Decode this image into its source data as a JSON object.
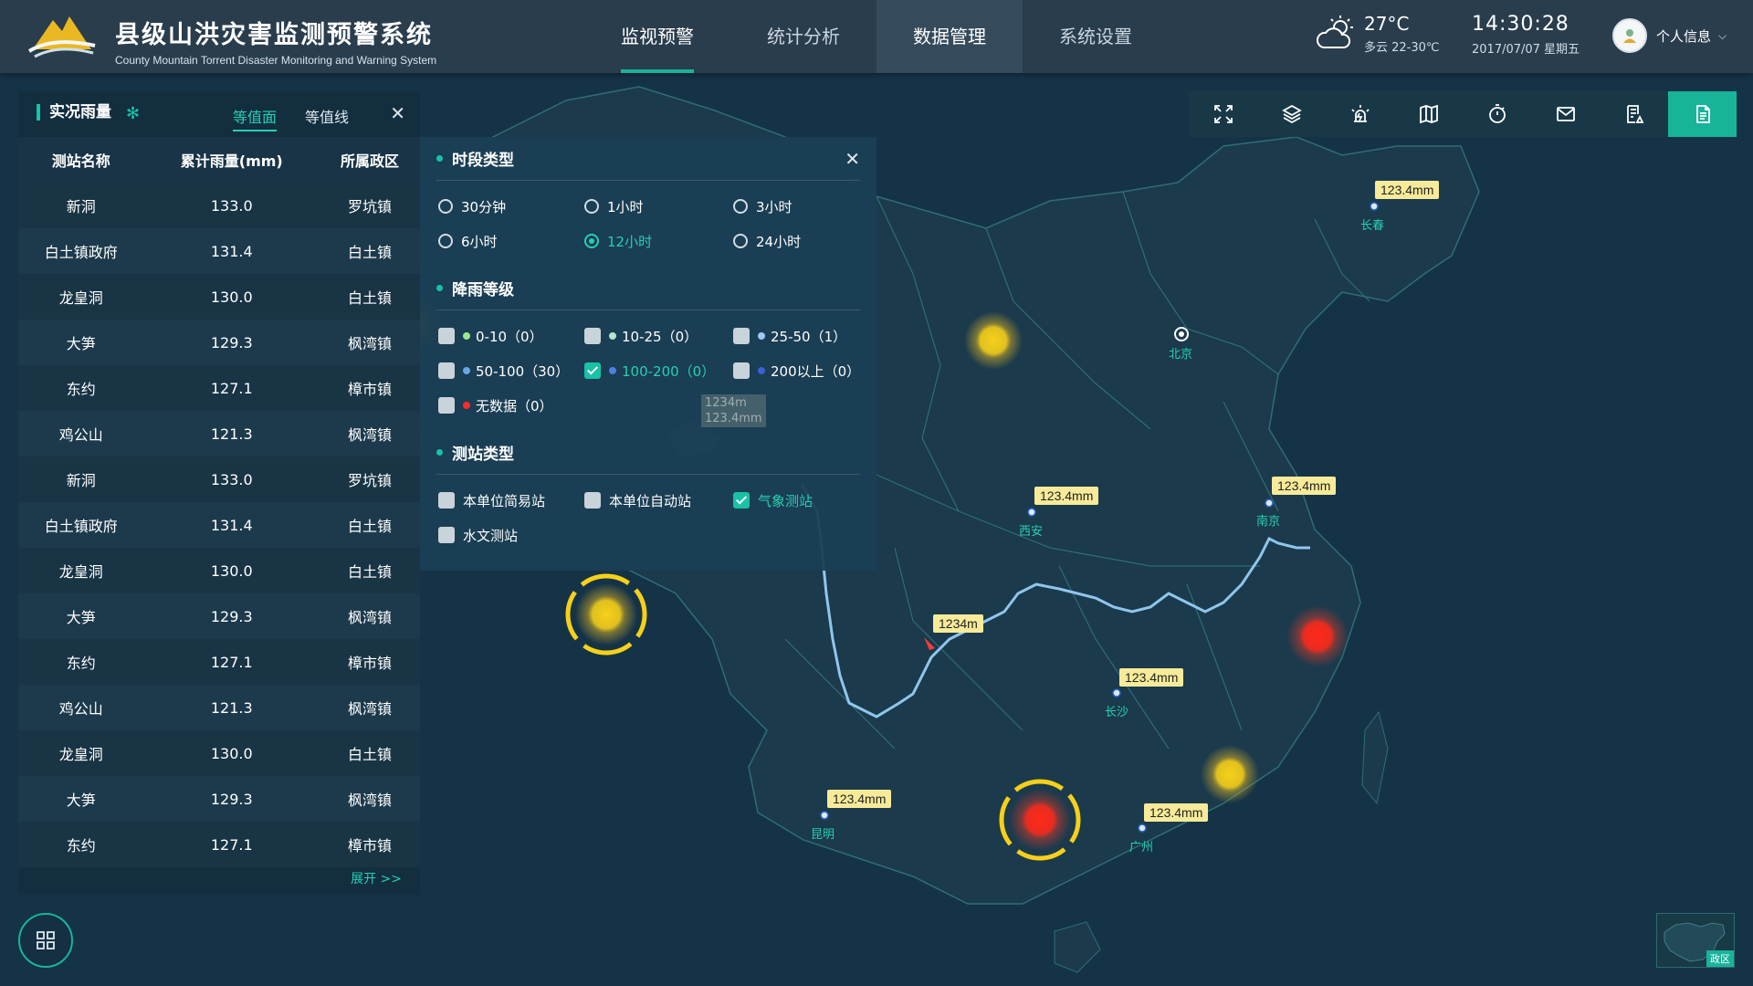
{
  "header": {
    "title_cn": "县级山洪灾害监测预警系统",
    "title_en": "County Mountain Torrent Disaster Monitoring and Warning System",
    "nav": [
      {
        "label": "监视预警",
        "state": "active"
      },
      {
        "label": "统计分析",
        "state": ""
      },
      {
        "label": "数据管理",
        "state": "hover"
      },
      {
        "label": "系统设置",
        "state": ""
      }
    ],
    "weather": {
      "temp": "27°C",
      "desc": "多云 22-30℃",
      "icon": "cloud-sun-icon"
    },
    "clock": {
      "time": "14:30:28",
      "date": "2017/07/07 星期五"
    },
    "user": {
      "label": "个人信息",
      "caret": "⌵"
    }
  },
  "rain_panel": {
    "title": "实况雨量",
    "tabs": [
      "等值面",
      "等值线"
    ],
    "active_tab": 0,
    "columns": [
      "测站名称",
      "累计雨量(mm)",
      "所属政区"
    ],
    "rows": [
      [
        "新洞",
        "133.0",
        "罗坑镇"
      ],
      [
        "白土镇政府",
        "131.4",
        "白土镇"
      ],
      [
        "龙皇洞",
        "130.0",
        "白土镇"
      ],
      [
        "大笋",
        "129.3",
        "枫湾镇"
      ],
      [
        "东约",
        "127.1",
        "樟市镇"
      ],
      [
        "鸡公山",
        "121.3",
        "枫湾镇"
      ],
      [
        "新洞",
        "133.0",
        "罗坑镇"
      ],
      [
        "白土镇政府",
        "131.4",
        "白土镇"
      ],
      [
        "龙皇洞",
        "130.0",
        "白土镇"
      ],
      [
        "大笋",
        "129.3",
        "枫湾镇"
      ],
      [
        "东约",
        "127.1",
        "樟市镇"
      ],
      [
        "鸡公山",
        "121.3",
        "枫湾镇"
      ],
      [
        "龙皇洞",
        "130.0",
        "白土镇"
      ],
      [
        "大笋",
        "129.3",
        "枫湾镇"
      ],
      [
        "东约",
        "127.1",
        "樟市镇"
      ]
    ],
    "expand": "展开 >>"
  },
  "filter_panel": {
    "period": {
      "title": "时段类型",
      "options": [
        "30分钟",
        "1小时",
        "3小时",
        "6小时",
        "12小时",
        "24小时"
      ],
      "selected": 4
    },
    "rain_level": {
      "title": "降雨等级",
      "options": [
        {
          "label": "0-10（0）",
          "color": "#9ee68a",
          "checked": false
        },
        {
          "label": "10-25（0）",
          "color": "#b6e4cf",
          "checked": false
        },
        {
          "label": "25-50（1）",
          "color": "#9ec8f0",
          "checked": false
        },
        {
          "label": "50-100（30）",
          "color": "#6aa7e8",
          "checked": false
        },
        {
          "label": "100-200（0）",
          "color": "#4e7fe0",
          "checked": true
        },
        {
          "label": "200以上（0）",
          "color": "#3d5ed6",
          "checked": false
        },
        {
          "label": "无数据（0）",
          "color": "#ff2b2b",
          "checked": false
        }
      ]
    },
    "station_type": {
      "title": "测站类型",
      "options": [
        {
          "label": "本单位简易站",
          "checked": false
        },
        {
          "label": "本单位自动站",
          "checked": false
        },
        {
          "label": "气象测站",
          "checked": true
        },
        {
          "label": "水文测站",
          "checked": false
        }
      ]
    }
  },
  "toolbar": {
    "buttons": [
      "fullscreen-icon",
      "layers-icon",
      "alarm-icon",
      "map-icon",
      "timer-icon",
      "mail-icon",
      "report-icon",
      "document-icon"
    ],
    "active": 7
  },
  "map": {
    "value_tags": [
      "123.4mm",
      "123.4mm",
      "123.4mm",
      "1234m",
      "123.4mm",
      "123.4mm",
      "123.4mm"
    ],
    "ghost_tag": [
      "1234m",
      "123.4mm"
    ],
    "cities": [
      "长春",
      "北京",
      "西安",
      "南京",
      "长沙",
      "昆明",
      "广州"
    ],
    "minimap_label": "政区"
  }
}
